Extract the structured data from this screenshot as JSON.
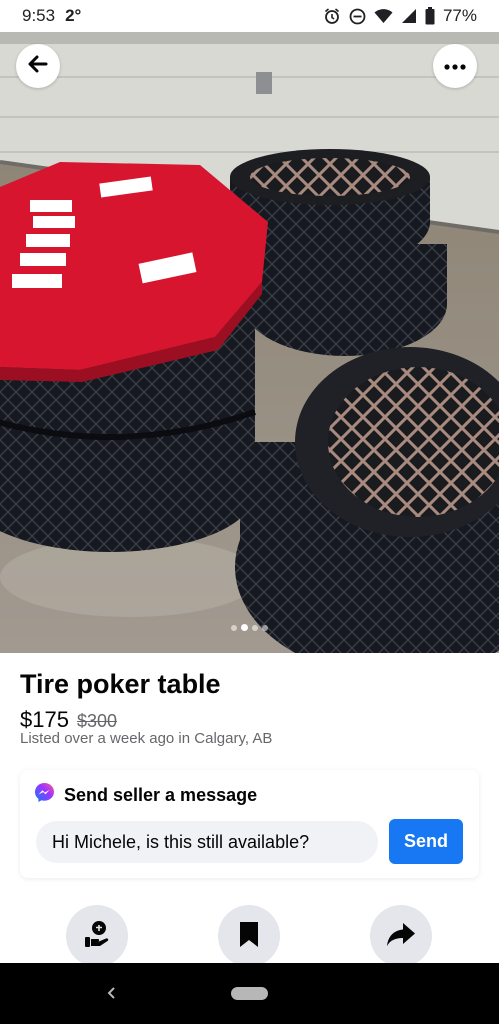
{
  "status_bar": {
    "time": "9:53",
    "temperature": "2°",
    "battery": "77%",
    "icons": [
      "alarm-icon",
      "do-not-disturb-icon",
      "wifi-icon",
      "cellular-signal-icon",
      "battery-icon"
    ]
  },
  "photo": {
    "description_icon": "listing-photo",
    "back_icon": "back-arrow-icon",
    "more_icon": "more-options-icon",
    "page_count": 4,
    "active_page": 2
  },
  "listing": {
    "title": "Tire poker table",
    "price": "$175",
    "original_price": "$300",
    "listed": "Listed over a week ago in Calgary, AB"
  },
  "message": {
    "header": "Send seller a message",
    "input_value": "Hi Michele, is this still available?",
    "send_label": "Send",
    "icon": "messenger-icon"
  },
  "actions": [
    {
      "icon": "make-offer-icon"
    },
    {
      "icon": "save-bookmark-icon"
    },
    {
      "icon": "share-icon"
    }
  ],
  "navbar": {
    "back_icon": "nav-back-icon",
    "home_icon": "nav-home-pill"
  },
  "colors": {
    "accent": "#1877f2",
    "felt": "#d7152f",
    "text_primary": "#050505",
    "text_secondary": "#65676b"
  }
}
